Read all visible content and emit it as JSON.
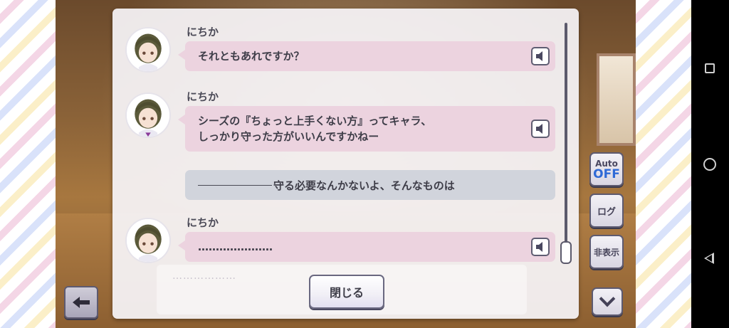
{
  "log": {
    "entries": [
      {
        "speaker": "にちか",
        "text": "それともあれですか？"
      },
      {
        "speaker": "にちか",
        "text_line1": "シーズの『ちょっと上手くない方』ってキャラ、",
        "text_line2": "しっかり守った方がいいんですかねー"
      },
      {
        "speaker": "にちか",
        "text": "…………………"
      }
    ],
    "narration": "守る必要なんかないよ、そんなものは",
    "background_ghost": "………………",
    "close_label": "閉じる"
  },
  "side_buttons": {
    "auto_label": "Auto",
    "auto_state": "OFF",
    "log_label": "ログ",
    "hide_label": "非表示"
  },
  "colors": {
    "bubble": "#ecd3df",
    "narration": "#d1d4dc",
    "auto_off": "#2f6ad6"
  }
}
